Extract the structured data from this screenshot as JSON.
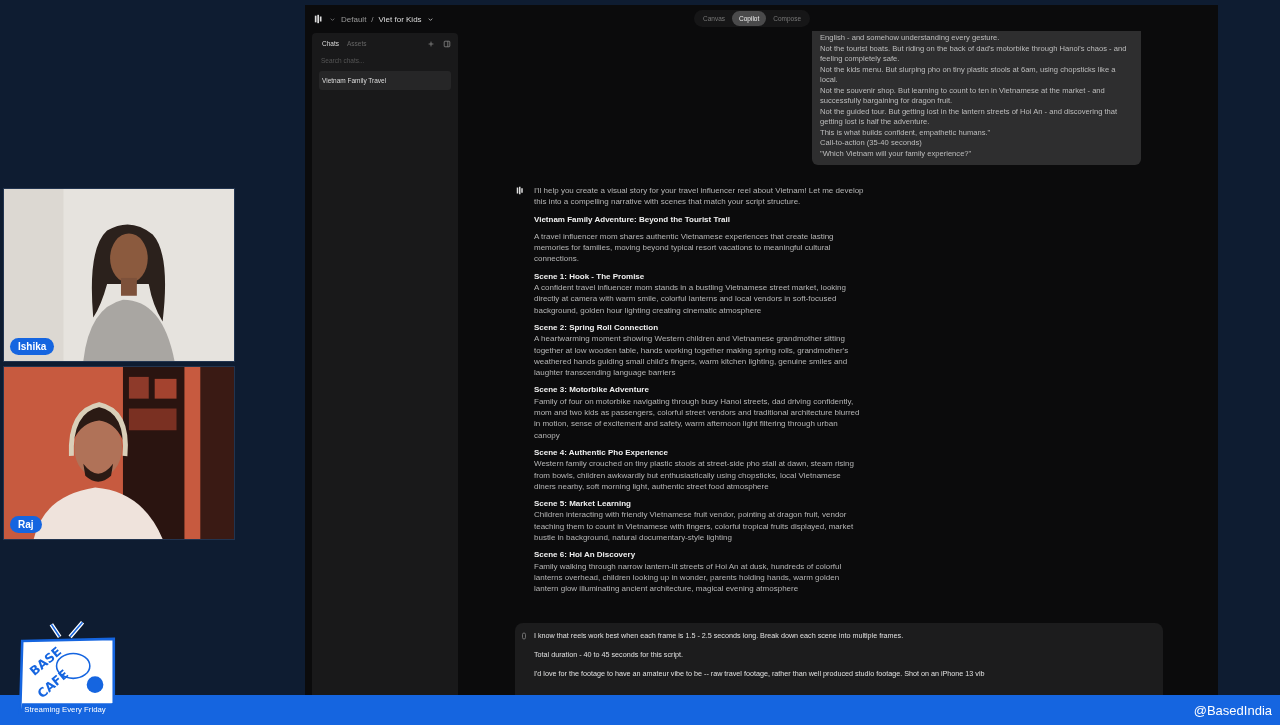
{
  "stream": {
    "webcams": [
      {
        "name": "Ishika",
        "kind": "light-room"
      },
      {
        "name": "Raj",
        "kind": "orange-room"
      }
    ],
    "logo": {
      "wordmark": [
        "BASE",
        "CAFE"
      ],
      "tagline": "Streaming Every Friday"
    },
    "handle": "@BasedIndia"
  },
  "app": {
    "breadcrumb": {
      "workspace": "Default",
      "separator": "/",
      "project": "Viet for Kids"
    },
    "mode_tabs": [
      {
        "label": "Canvas",
        "selected": false
      },
      {
        "label": "Copilot",
        "selected": true
      },
      {
        "label": "Compose",
        "selected": false
      }
    ],
    "sidebar": {
      "tabs": [
        {
          "label": "Chats",
          "selected": true
        },
        {
          "label": "Assets",
          "selected": false
        }
      ],
      "search": {
        "placeholder": "Search chats..."
      },
      "chats": [
        {
          "title": "Vietnam Family Travel",
          "selected": true
        }
      ]
    },
    "user_message": {
      "lines": [
        "English - and somehow understanding every gesture.",
        "Not the tourist boats. But riding on the back of dad's motorbike through Hanoi's chaos - and feeling completely safe.",
        "Not the kids menu. But slurping pho on tiny plastic stools at 6am, using chopsticks like a local.",
        "Not the souvenir shop. But learning to count to ten in Vietnamese at the market - and successfully bargaining for dragon fruit.",
        "Not the guided tour. But getting lost in the lantern streets of Hoi An - and discovering that getting lost is half the adventure.",
        "This is what builds confident, empathetic humans.\"",
        "Call-to-action (35-40 seconds)",
        "\"Which Vietnam will your family experience?\""
      ]
    },
    "assistant_message": {
      "intro": "I'll help you create a visual story for your travel influencer reel about Vietnam! Let me develop this into a compelling narrative with scenes that match your script structure.",
      "title": "Vietnam Family Adventure: Beyond the Tourist Trail",
      "summary": "A travel influencer mom shares authentic Vietnamese experiences that create lasting memories for families, moving beyond typical resort vacations to meaningful cultural connections.",
      "scenes": [
        {
          "heading": "Scene 1: Hook - The Promise",
          "text": "A confident travel influencer mom stands in a bustling Vietnamese street market, looking directly at camera with warm smile, colorful lanterns and local vendors in soft-focused background, golden hour lighting creating cinematic atmosphere"
        },
        {
          "heading": "Scene 2: Spring Roll Connection",
          "text": "A heartwarming moment showing Western children and Vietnamese grandmother sitting together at low wooden table, hands working together making spring rolls, grandmother's weathered hands guiding small child's fingers, warm kitchen lighting, genuine smiles and laughter transcending language barriers"
        },
        {
          "heading": "Scene 3: Motorbike Adventure",
          "text": "Family of four on motorbike navigating through busy Hanoi streets, dad driving confidently, mom and two kids as passengers, colorful street vendors and traditional architecture blurred in motion, sense of excitement and safety, warm afternoon light filtering through urban canopy"
        },
        {
          "heading": "Scene 4: Authentic Pho Experience",
          "text": "Western family crouched on tiny plastic stools at street-side pho stall at dawn, steam rising from bowls, children awkwardly but enthusiastically using chopsticks, local Vietnamese diners nearby, soft morning light, authentic street food atmosphere"
        },
        {
          "heading": "Scene 5: Market Learning",
          "text": "Children interacting with friendly Vietnamese fruit vendor, pointing at dragon fruit, vendor teaching them to count in Vietnamese with fingers, colorful tropical fruits displayed, market bustle in background, natural documentary-style lighting"
        },
        {
          "heading": "Scene 6: Hoi An Discovery",
          "text": "Family walking through narrow lantern-lit streets of Hoi An at dusk, hundreds of colorful lanterns overhead, children looking up in wonder, parents holding hands, warm golden lantern glow illuminating ancient architecture, magical evening atmosphere"
        }
      ]
    },
    "composer": {
      "paragraphs": [
        "I know that reels work best when each frame is 1.5 - 2.5 seconds long. Break down each scene into multiple frames.",
        "Total duration - 40 to 45 seconds for this script.",
        "I'd love for the footage to have an amateur vibe to be -- raw travel footage, rather than well produced studio footage. Shot on an iPhone 13 vib"
      ]
    }
  }
}
